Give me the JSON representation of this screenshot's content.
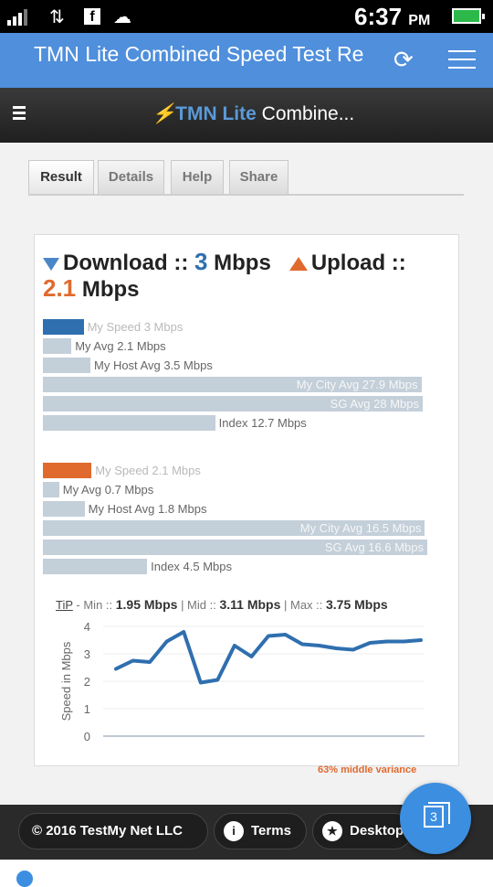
{
  "status_bar": {
    "time": "6:37",
    "ampm": "PM"
  },
  "app_bar": {
    "title": "TMN Lite Combined Speed Test Re",
    "refresh_icon": "refresh-icon",
    "menu_icon": "menu-icon"
  },
  "site_header": {
    "brand_bolt": "⚡",
    "brand_part1": "TMN Lite",
    "brand_part2": " Combine..."
  },
  "tabs": [
    {
      "label": "Result",
      "active": true
    },
    {
      "label": "Details",
      "active": false
    },
    {
      "label": "Help",
      "active": false
    },
    {
      "label": "Share",
      "active": false
    }
  ],
  "summary": {
    "download_label": "Download ::",
    "download_value": "3",
    "download_unit": "Mbps",
    "upload_label": "Upload ::",
    "upload_value": "2.1",
    "upload_unit": "Mbps"
  },
  "colors": {
    "download": "#2f6faf",
    "upload": "#e06a2e",
    "compare": "#c3cfd9",
    "accent": "#4f8fdc"
  },
  "download_bars": [
    {
      "label": "My Speed 3 Mbps",
      "value": 3
    },
    {
      "label": "My Avg 2.1 Mbps",
      "value": 2.1
    },
    {
      "label": "My Host Avg 3.5 Mbps",
      "value": 3.5
    },
    {
      "label": "My City Avg 27.9 Mbps",
      "value": 27.9
    },
    {
      "label": "SG Avg 28 Mbps",
      "value": 28
    },
    {
      "label": "Index 12.7 Mbps",
      "value": 12.7
    }
  ],
  "upload_bars": [
    {
      "label": "My Speed 2.1 Mbps",
      "value": 2.1
    },
    {
      "label": "My Avg 0.7 Mbps",
      "value": 0.7
    },
    {
      "label": "My Host Avg 1.8 Mbps",
      "value": 1.8
    },
    {
      "label": "My City Avg 16.5 Mbps",
      "value": 16.5
    },
    {
      "label": "SG Avg 16.6 Mbps",
      "value": 16.6
    },
    {
      "label": "Index 4.5 Mbps",
      "value": 4.5
    }
  ],
  "tip": {
    "tip_label": "TiP",
    "min_label": " - Min :: ",
    "min_value": "1.95",
    "mid_label": " | Mid :: ",
    "mid_value": "3.11",
    "max_label": " | Max :: ",
    "max_value": "3.75",
    "unit": " Mbps"
  },
  "chart_data": {
    "type": "line",
    "title": "",
    "xlabel": "",
    "ylabel": "Speed in Mbps",
    "ylim": [
      0,
      4
    ],
    "yticks": [
      0,
      1,
      2,
      3,
      4
    ],
    "grid": true,
    "series": [
      {
        "values": [
          2.45,
          2.75,
          2.7,
          3.45,
          3.8,
          1.95,
          2.05,
          3.3,
          2.9,
          3.65,
          3.7,
          3.35,
          3.3,
          3.2,
          3.15,
          3.4,
          3.45,
          3.45,
          3.5
        ]
      }
    ]
  },
  "variance_note": "63% middle variance",
  "footer": {
    "copyright": "© 2016 TestMy Net LLC",
    "terms": "Terms",
    "desktop": "Desktop",
    "fab_count": "3"
  }
}
